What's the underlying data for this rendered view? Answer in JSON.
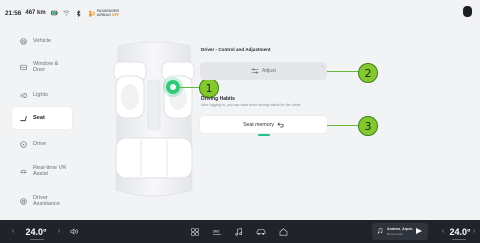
{
  "status": {
    "time": "21:56",
    "range": "467 km",
    "airbag_line1": "PASSENGER",
    "airbag_line2": "AIRBAG",
    "airbag_state": "OFF",
    "icons": [
      "battery-icon",
      "wifi-icon",
      "bluetooth-icon",
      "airbag-icon",
      "profile-icon"
    ]
  },
  "sidebar": {
    "items": [
      {
        "label": "Vehicle",
        "icon": "vehicle-icon"
      },
      {
        "label": "Window & Door",
        "icon": "window-door-icon"
      },
      {
        "label": "Lights",
        "icon": "lights-icon"
      },
      {
        "label": "Seat",
        "icon": "seat-icon",
        "active": true
      },
      {
        "label": "Drive",
        "icon": "drive-icon"
      },
      {
        "label": "Real-time VR Assist",
        "icon": "vr-assist-icon"
      },
      {
        "label": "Driver Assistance",
        "icon": "driver-assistance-icon"
      }
    ]
  },
  "panel": {
    "section_title": "Driver - Control and Adjustment",
    "adjust_label": "Adjust",
    "habits_title": "Driving Habits",
    "habits_desc": "After logging in, you can save more driving habits for the driver",
    "memory_label": "Seat memory"
  },
  "annotations": {
    "marker1": "1",
    "marker2": "2",
    "marker3": "3",
    "color": "#82c82e"
  },
  "bottom": {
    "left_temp": "24.0°",
    "right_temp": "24.0°",
    "media_title": "Andrew_Arpot..",
    "media_subtitle": "Bonus track",
    "icons": [
      "volume-icon",
      "apps-grid-icon",
      "camera-360-icon",
      "music-icon",
      "car-icon",
      "home-icon"
    ]
  },
  "colors": {
    "accent_green": "#23c18a",
    "annotation_green": "#82c82e",
    "bottom_bar": "#20232a"
  }
}
